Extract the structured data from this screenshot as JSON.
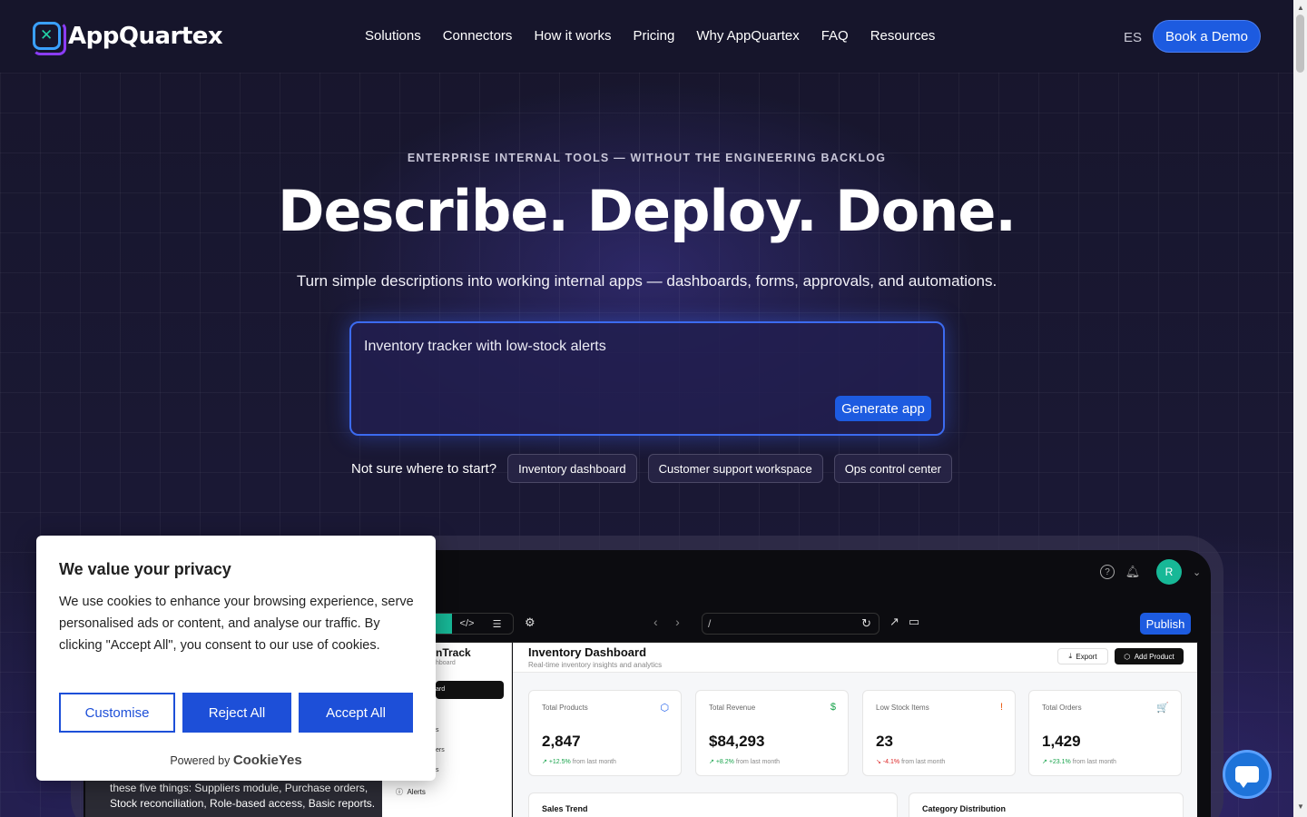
{
  "brand": {
    "name": "AppQuartex",
    "mark": "✕"
  },
  "nav": {
    "links": [
      "Solutions",
      "Connectors",
      "How it works",
      "Pricing",
      "Why AppQuartex",
      "FAQ",
      "Resources"
    ],
    "lang": "ES",
    "cta": "Book a Demo"
  },
  "hero": {
    "eyebrow": "ENTERPRISE INTERNAL TOOLS — WITHOUT THE ENGINEERING BACKLOG",
    "headline": "Describe. Deploy. Done.",
    "subline": "Turn simple descriptions into working internal apps — dashboards, forms, approvals, and automations.",
    "prompt_value": "Inventory tracker with low-stock alerts",
    "generate_label": "Generate app",
    "starters_label": "Not sure where to start?",
    "starters": [
      "Inventory dashboard",
      "Customer support workspace",
      "Ops control center"
    ]
  },
  "preview": {
    "avatar_initial": "R",
    "url": "/",
    "publish_label": "Publish",
    "sidebar": {
      "brand": "nTrack",
      "brand_sub": "hboard",
      "active_item": "ard",
      "fragments": [
        "s",
        "ers",
        "s"
      ],
      "alerts": "Alerts"
    },
    "title": "Inventory Dashboard",
    "subtitle": "Real-time inventory insights and analytics",
    "export_label": "Export",
    "add_label": "Add Product",
    "stats": [
      {
        "label": "Total Products",
        "value": "2,847",
        "delta": "+12.5%",
        "delta_dir": "up",
        "suffix": "from last month",
        "icon": "⬡",
        "icon_color": "#2563eb"
      },
      {
        "label": "Total Revenue",
        "value": "$84,293",
        "delta": "+8.2%",
        "delta_dir": "up",
        "suffix": "from last month",
        "icon": "$",
        "icon_color": "#16a34a"
      },
      {
        "label": "Low Stock Items",
        "value": "23",
        "delta": "-4.1%",
        "delta_dir": "down",
        "suffix": "from last month",
        "icon": "!",
        "icon_color": "#ea580c"
      },
      {
        "label": "Total Orders",
        "value": "1,429",
        "delta": "+23.1%",
        "delta_dir": "up",
        "suffix": "from last month",
        "icon": "🛒",
        "icon_color": "#9333ea"
      }
    ],
    "panels": [
      "Sales Trend",
      "Category Distribution"
    ],
    "chat_text": "these five things: Suppliers module, Purchase orders, Stock reconciliation, Role-based access, Basic reports."
  },
  "cookie": {
    "title": "We value your privacy",
    "body": "We use cookies to enhance your browsing experience, serve personalised ads or content, and analyse our traffic. By clicking \"Accept All\", you consent to our use of cookies.",
    "customise": "Customise",
    "reject": "Reject All",
    "accept": "Accept All",
    "powered_by": "Powered by",
    "powered_brand": "CookieYes"
  }
}
